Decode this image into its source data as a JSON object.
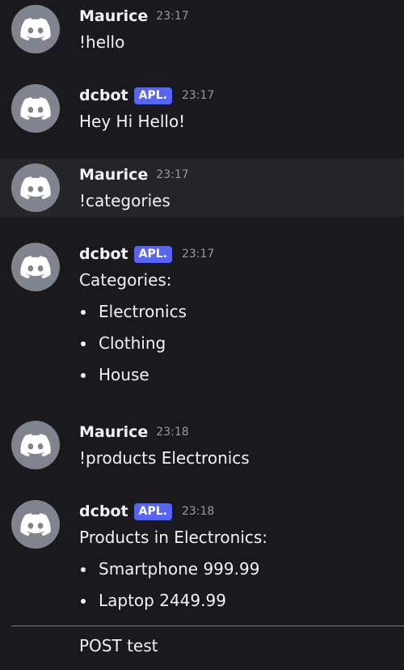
{
  "messages": [
    {
      "author": "Maurice",
      "time": "23:17",
      "text": "!hello"
    },
    {
      "author": "dcbot",
      "tag": "APL.",
      "time": "23:17",
      "text": "Hey Hi Hello!"
    },
    {
      "author": "Maurice",
      "time": "23:17",
      "text": "!categories"
    },
    {
      "author": "dcbot",
      "tag": "APL.",
      "time": "23:17",
      "text": "Categories:",
      "items": [
        "Electronics",
        "Clothing",
        "House"
      ]
    },
    {
      "author": "Maurice",
      "time": "23:18",
      "text": "!products Electronics"
    },
    {
      "author": "dcbot",
      "tag": "APL.",
      "time": "23:18",
      "text": "Products in Electronics:",
      "items": [
        "Smartphone 999.99",
        "Laptop 2449.99"
      ]
    }
  ],
  "unsent_text": "POST test",
  "colors": {
    "background": "#1a1a1e",
    "highlight": "#242429",
    "app_tag": "#5865f2",
    "avatar": "#80848e",
    "divider": "#f23f43"
  },
  "icons": {
    "avatar": "discord-logo-icon"
  }
}
